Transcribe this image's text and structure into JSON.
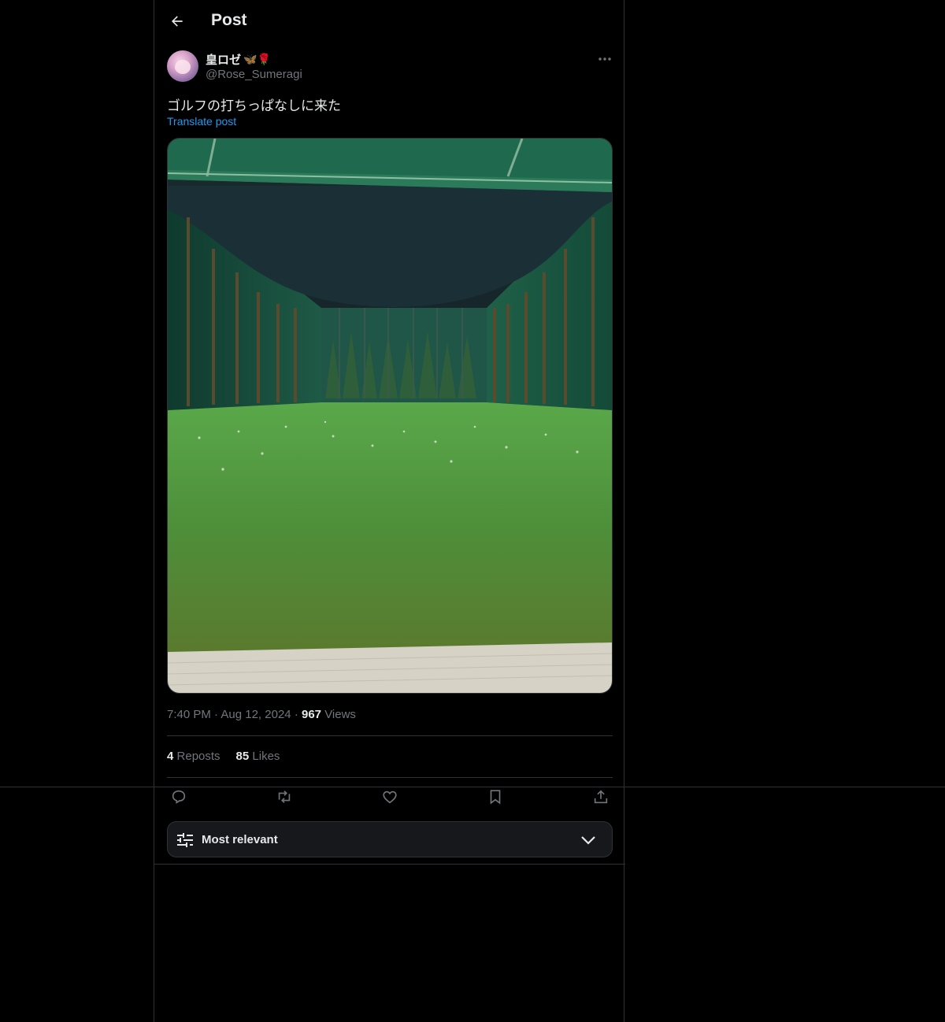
{
  "header": {
    "title": "Post"
  },
  "post": {
    "author_name": "皇ロゼ",
    "author_emoji": "🦋🌹",
    "handle": "@Rose_Sumeragi",
    "text": "ゴルフの打ちっぱなしに来た",
    "translate_label": "Translate post",
    "time": "7:40 PM",
    "date": "Aug 12, 2024",
    "views_count": "967",
    "views_label": "Views",
    "reposts_count": "4",
    "reposts_label": "Reposts",
    "likes_count": "85",
    "likes_label": "Likes"
  },
  "sort": {
    "label": "Most relevant"
  },
  "colors": {
    "accent": "#1d9bf0",
    "background": "#000000",
    "border": "#2f3336",
    "muted": "#71767b"
  }
}
